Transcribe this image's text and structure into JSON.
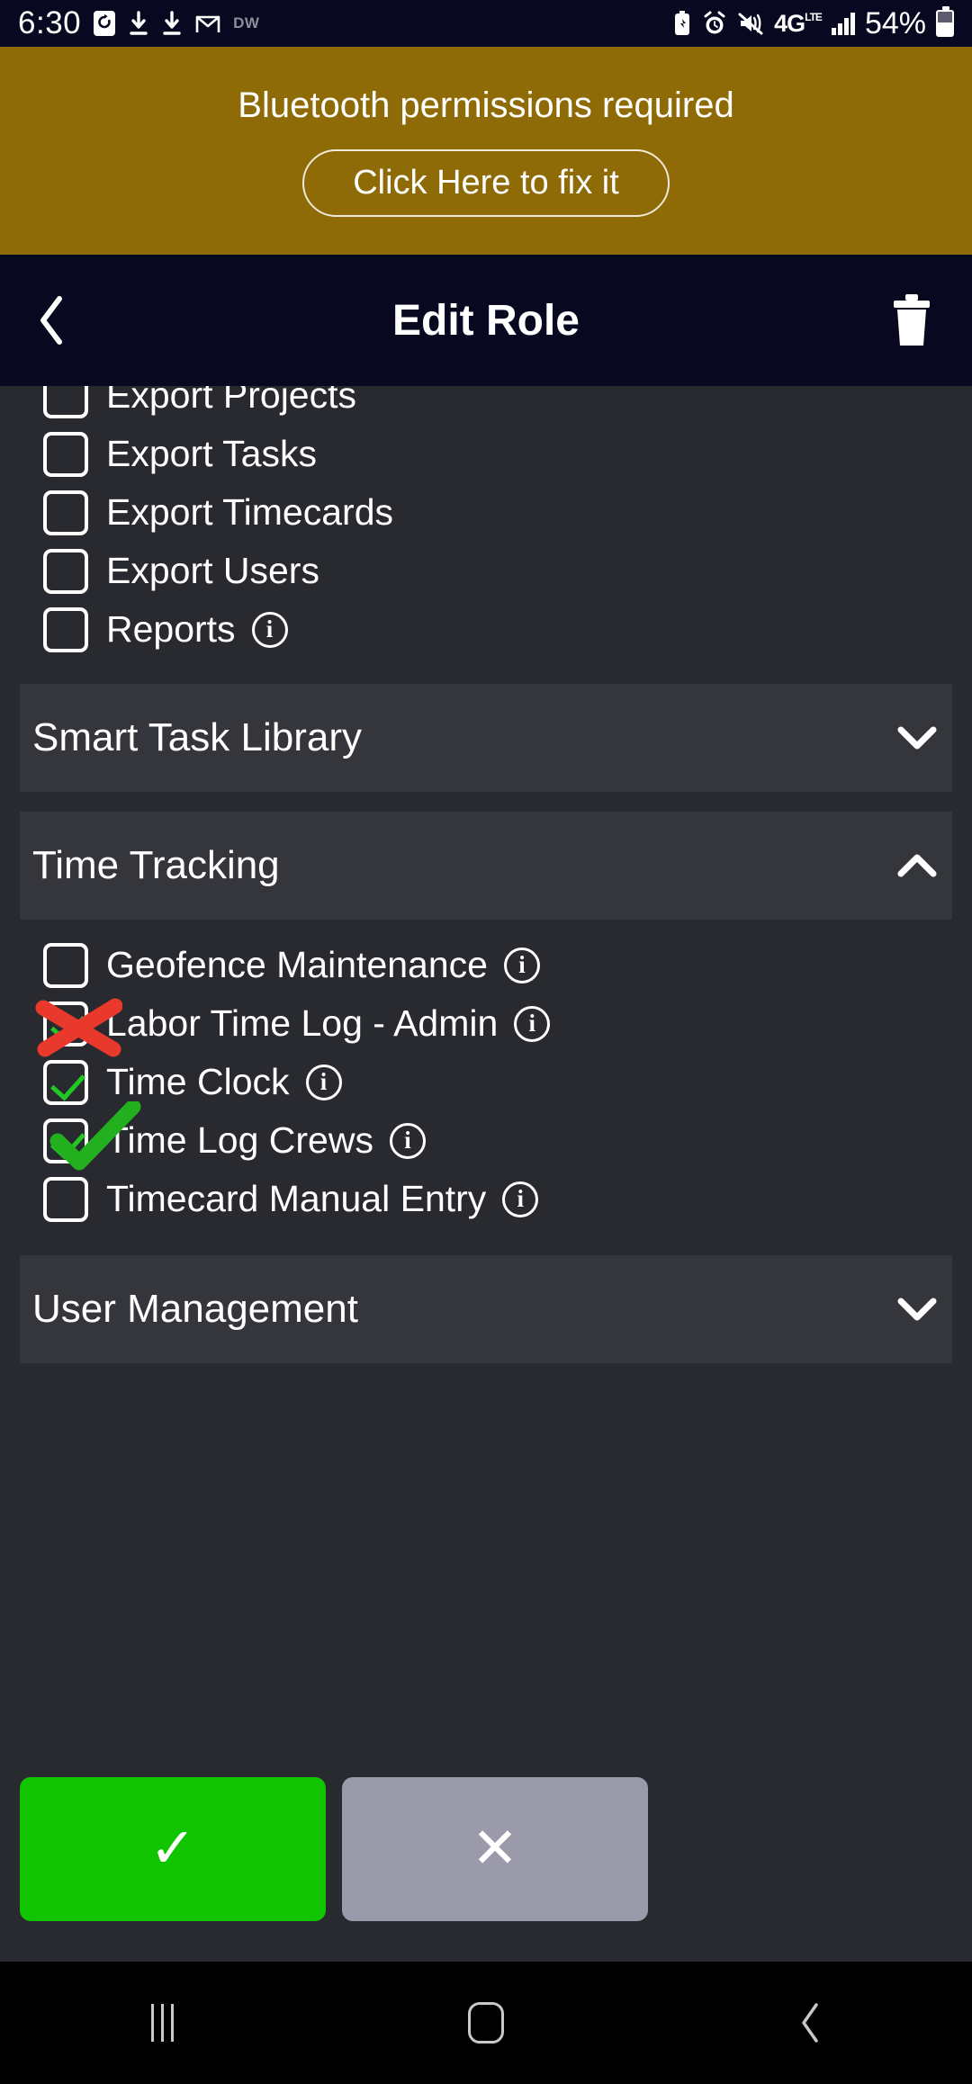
{
  "status_bar": {
    "time": "6:30",
    "left_icons": [
      "sync-badge-icon",
      "download-arrow-icon",
      "download-arrow-icon",
      "gmail-icon"
    ],
    "left_text_badge": "DW",
    "right_icons": [
      "battery-saver-icon",
      "alarm-icon",
      "vibrate-mute-icon"
    ],
    "network": "4G",
    "network_sup": "LTE",
    "signal": "signal-bars-icon",
    "battery_percent": "54%",
    "battery_icon": "battery-icon"
  },
  "banner": {
    "message": "Bluetooth permissions required",
    "action_label": "Click Here to fix it",
    "background": "#8e6b06"
  },
  "appbar": {
    "back_icon": "back-chevron-icon",
    "title": "Edit Role",
    "delete_icon": "trash-icon"
  },
  "permissions": {
    "visible_rows": [
      {
        "label": "Export Projects",
        "checked": false,
        "has_info": false,
        "clipped": true
      },
      {
        "label": "Export Tasks",
        "checked": false,
        "has_info": false
      },
      {
        "label": "Export Timecards",
        "checked": false,
        "has_info": false
      },
      {
        "label": "Export Users",
        "checked": false,
        "has_info": false
      },
      {
        "label": "Reports",
        "checked": false,
        "has_info": true
      }
    ]
  },
  "sections": [
    {
      "title": "Smart Task Library",
      "expanded": false,
      "chevron": "chevron-down-icon"
    },
    {
      "title": "Time Tracking",
      "expanded": true,
      "chevron": "chevron-up-icon"
    },
    {
      "title": "User Management",
      "expanded": false,
      "chevron": "chevron-down-icon"
    }
  ],
  "time_tracking_rows": [
    {
      "label": "Geofence Maintenance",
      "checked": false,
      "has_info": true,
      "annotation": "none"
    },
    {
      "label": "Labor Time Log - Admin",
      "checked": true,
      "has_info": true,
      "annotation": "red-x"
    },
    {
      "label": "Time Clock",
      "checked": true,
      "has_info": true,
      "annotation": "none"
    },
    {
      "label": "Time Log Crews",
      "checked": true,
      "has_info": true,
      "annotation": "green-check"
    },
    {
      "label": "Timecard Manual Entry",
      "checked": false,
      "has_info": true,
      "annotation": "none"
    }
  ],
  "info_glyph": "i",
  "actions": {
    "confirm_glyph": "✓",
    "confirm_name": "save-button",
    "confirm_color": "#11c400",
    "cancel_glyph": "✕",
    "cancel_name": "cancel-button",
    "cancel_color": "#9a9aaa"
  },
  "navbar": {
    "recents": "recents-icon",
    "home": "home-icon",
    "back": "back-icon"
  },
  "colors": {
    "page_background": "#292930",
    "section_header": "#35353c",
    "appbar": "#080820",
    "annotation_red": "#e8392c",
    "annotation_green": "#23b01f",
    "checkbox_green": "#23c722"
  }
}
